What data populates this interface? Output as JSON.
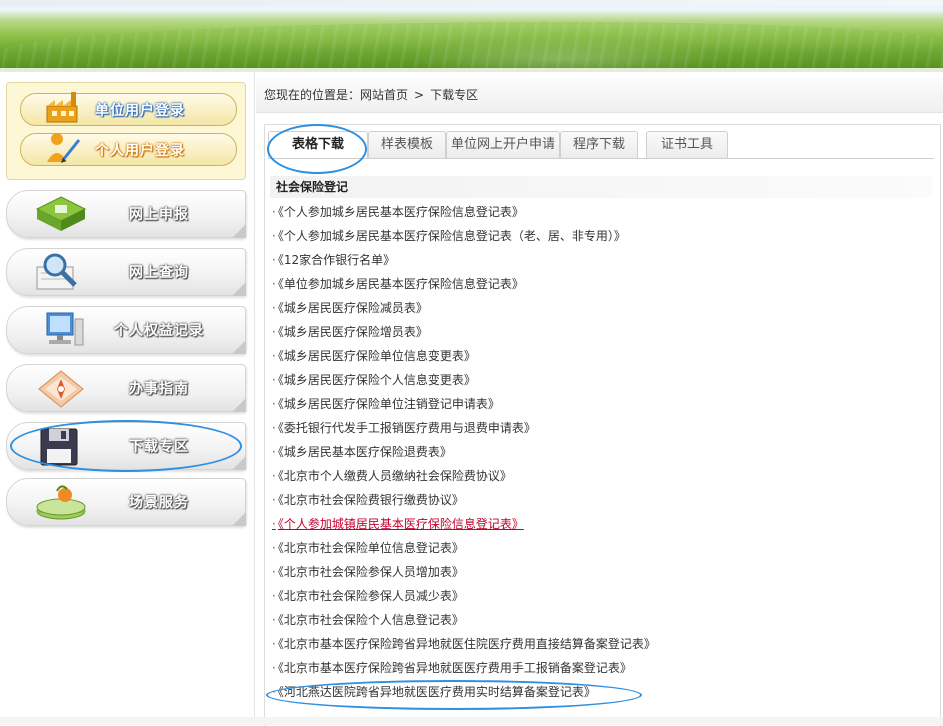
{
  "sidebar": {
    "login": {
      "unit_label": "单位用户登录",
      "personal_label": "个人用户登录"
    },
    "nav": [
      {
        "label": "网上申报",
        "icon": "online-declare-icon"
      },
      {
        "label": "网上查询",
        "icon": "magnifier-icon"
      },
      {
        "label": "个人权益记录",
        "icon": "computer-icon"
      },
      {
        "label": "办事指南",
        "icon": "compass-icon"
      },
      {
        "label": "下载专区",
        "icon": "floppy-disk-icon"
      },
      {
        "label": "场景服务",
        "icon": "scene-icon"
      }
    ]
  },
  "breadcrumb": {
    "prefix": "您现在的位置是：",
    "home": "网站首页",
    "separator": ">",
    "current": "下载专区"
  },
  "tabs": [
    {
      "label": "表格下载",
      "active": true
    },
    {
      "label": "样表模板",
      "active": false
    },
    {
      "label": "单位网上开户申请",
      "active": false
    },
    {
      "label": "程序下载",
      "active": false
    },
    {
      "label": "证书工具",
      "active": false
    }
  ],
  "section_title": "社会保险登记",
  "files": [
    "《个人参加城乡居民基本医疗保险信息登记表》",
    "《个人参加城乡居民基本医疗保险信息登记表（老、居、非专用）》",
    "《12家合作银行名单》",
    "《单位参加城乡居民基本医疗保险信息登记表》",
    "《城乡居民医疗保险减员表》",
    "《城乡居民医疗保险增员表》",
    "《城乡居民医疗保险单位信息变更表》",
    "《城乡居民医疗保险个人信息变更表》",
    "《城乡居民医疗保险单位注销登记申请表》",
    "《委托银行代发手工报销医疗费用与退费申请表》",
    "《城乡居民基本医疗保险退费表》",
    "《北京市个人缴费人员缴纳社会保险费协议》",
    "《北京市社会保险费银行缴费协议》",
    "《个人参加城镇居民基本医疗保险信息登记表》",
    "《北京市社会保险单位信息登记表》",
    "《北京市社会保险参保人员增加表》",
    "《北京市社会保险参保人员减少表》",
    "《北京市社会保险个人信息登记表》",
    "《北京市基本医疗保险跨省异地就医住院医疗费用直接结算备案登记表》",
    "《北京市基本医疗保险跨省异地就医医疗费用手工报销备案登记表》",
    "《河北燕达医院跨省异地就医医疗费用实时结算备案登记表》"
  ],
  "bullet": "·",
  "colors": {
    "highlight_circle": "#2f8fe0",
    "link_hover": "#c0002a",
    "unit_login_text_outline": "#2b6cb8",
    "personal_login_text_outline": "#d67a00"
  }
}
